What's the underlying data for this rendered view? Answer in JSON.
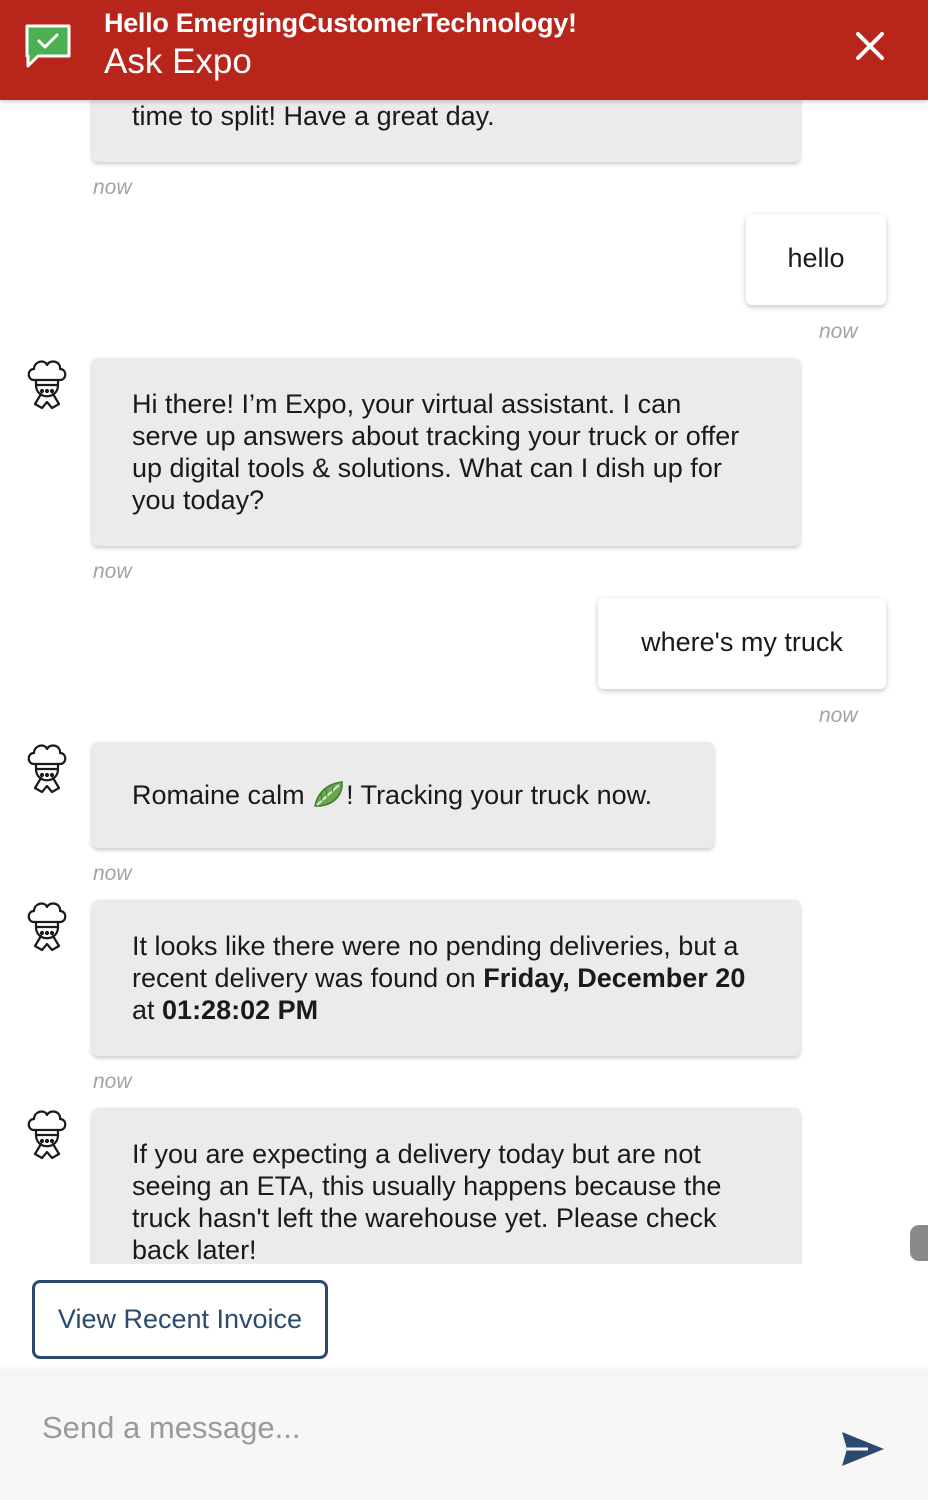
{
  "header": {
    "greeting": "Hello EmergingCustomerTechnology!",
    "title": "Ask Expo"
  },
  "messages": [
    {
      "from": "bot",
      "lines": [
        "time to split! Have a great day."
      ],
      "time": "now"
    },
    {
      "from": "user",
      "text": "hello",
      "time": "now"
    },
    {
      "from": "bot",
      "text": "Hi there! I’m Expo, your virtual assistant. I can serve up answers about tracking your truck or offer up digital tools & solutions. What can I dish up for you today?",
      "time": "now"
    },
    {
      "from": "user",
      "text": "where's my truck",
      "time": "now"
    },
    {
      "from": "bot",
      "text_before": "Romaine calm ",
      "emoji": "leafy-green-emoji",
      "text_after": "! Tracking your truck now.",
      "time": "now"
    },
    {
      "from": "bot",
      "text_pre": "It looks like there were no pending deliveries, but a recent delivery was found on ",
      "date": "Friday, December 20",
      "text_mid": " at ",
      "clock": "01:28:02 PM",
      "time": "now"
    },
    {
      "from": "bot",
      "text": "If you are expecting a delivery today but are not seeing an ETA, this usually happens because the truck hasn't left the warehouse yet. Please check back later!"
    }
  ],
  "quick_reply": {
    "label": "View Recent Invoice"
  },
  "composer": {
    "placeholder": "Send a message..."
  },
  "colors": {
    "header": "#b8261b",
    "accent": "#2c4a6e",
    "bot_bubble": "#ebebeb",
    "user_bubble": "#ffffff",
    "chat_icon": "#4caf50"
  },
  "icons": [
    "chat-check-icon",
    "close-icon",
    "chef-avatar-icon",
    "send-icon"
  ]
}
